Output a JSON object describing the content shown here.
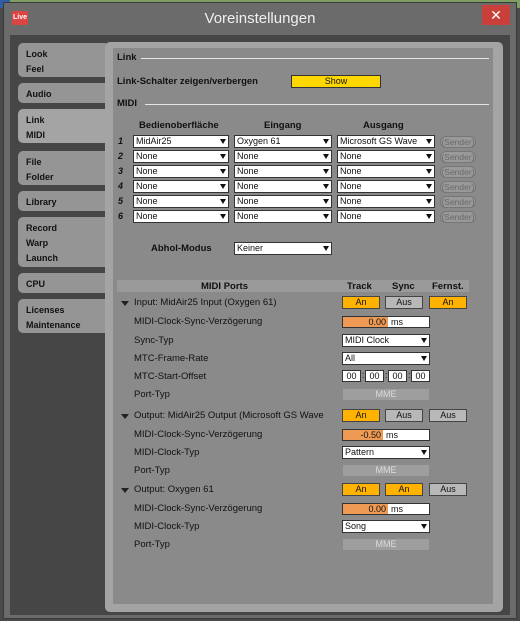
{
  "window": {
    "title": "Voreinstellungen",
    "app_icon": "Live",
    "close": "✕"
  },
  "tabs": [
    {
      "lines": [
        "Look",
        "Feel"
      ]
    },
    {
      "lines": [
        "Audio"
      ]
    },
    {
      "lines": [
        "Link",
        "MIDI"
      ],
      "active": true
    },
    {
      "lines": [
        "File",
        "Folder"
      ]
    },
    {
      "lines": [
        "Library"
      ]
    },
    {
      "lines": [
        "Record",
        "Warp",
        "Launch"
      ]
    },
    {
      "lines": [
        "CPU"
      ]
    },
    {
      "lines": [
        "Licenses",
        "Maintenance"
      ]
    }
  ],
  "link": {
    "section": "Link",
    "toggle_label": "Link-Schalter zeigen/verbergen",
    "toggle_button": "Show"
  },
  "midi": {
    "section": "MIDI",
    "col_control": "Bedienoberfläche",
    "col_input": "Eingang",
    "col_output": "Ausgang",
    "sender": "(Sender)",
    "rows": [
      {
        "num": "1",
        "control": "MidAir25",
        "input": "Oxygen 61",
        "output": "Microsoft GS Wave"
      },
      {
        "num": "2",
        "control": "None",
        "input": "None",
        "output": "None"
      },
      {
        "num": "3",
        "control": "None",
        "input": "None",
        "output": "None"
      },
      {
        "num": "4",
        "control": "None",
        "input": "None",
        "output": "None"
      },
      {
        "num": "5",
        "control": "None",
        "input": "None",
        "output": "None"
      },
      {
        "num": "6",
        "control": "None",
        "input": "None",
        "output": "None"
      }
    ],
    "takeover_label": "Abhol-Modus",
    "takeover_value": "Keiner"
  },
  "ports": {
    "header": "MIDI Ports",
    "col_track": "Track",
    "col_sync": "Sync",
    "col_remote": "Fernst.",
    "groups": [
      {
        "title": "Input:   MidAir25 Input (Oxygen 61)",
        "track": "An",
        "sync": "Aus",
        "remote": "An",
        "track_on": true,
        "sync_on": false,
        "remote_on": true,
        "delay_label": "MIDI-Clock-Sync-Verzögerung",
        "delay_value": "0.00",
        "delay_unit": "ms",
        "row2_label": "Sync-Typ",
        "row2_value": "MIDI Clock",
        "row3_label": "MTC-Frame-Rate",
        "row3_value": "All",
        "row4_label": "MTC-Start-Offset",
        "timecode": [
          "00",
          "00",
          "00",
          "00"
        ],
        "port_label": "Port-Typ",
        "port_value": "MME"
      },
      {
        "title": "Output:  MidAir25 Output (Microsoft GS Wave",
        "track": "An",
        "sync": "Aus",
        "remote": "Aus",
        "track_on": true,
        "sync_on": false,
        "remote_on": false,
        "delay_label": "MIDI-Clock-Sync-Verzögerung",
        "delay_value": "-0.50",
        "delay_unit": "ms",
        "row2_label": "MIDI-Clock-Typ",
        "row2_value": "Pattern",
        "port_label": "Port-Typ",
        "port_value": "MME"
      },
      {
        "title": "Output:  Oxygen 61",
        "track": "An",
        "sync": "An",
        "remote": "Aus",
        "track_on": true,
        "sync_on": true,
        "remote_on": false,
        "delay_label": "MIDI-Clock-Sync-Verzögerung",
        "delay_value": "0.00",
        "delay_unit": "ms",
        "row2_label": "MIDI-Clock-Typ",
        "row2_value": "Song",
        "port_label": "Port-Typ",
        "port_value": "MME"
      }
    ]
  },
  "colors": {
    "accent": "#ffb300",
    "show_button": "#ffd700",
    "value_fill": "#ee9a54",
    "panel": "#8a8a8a"
  }
}
